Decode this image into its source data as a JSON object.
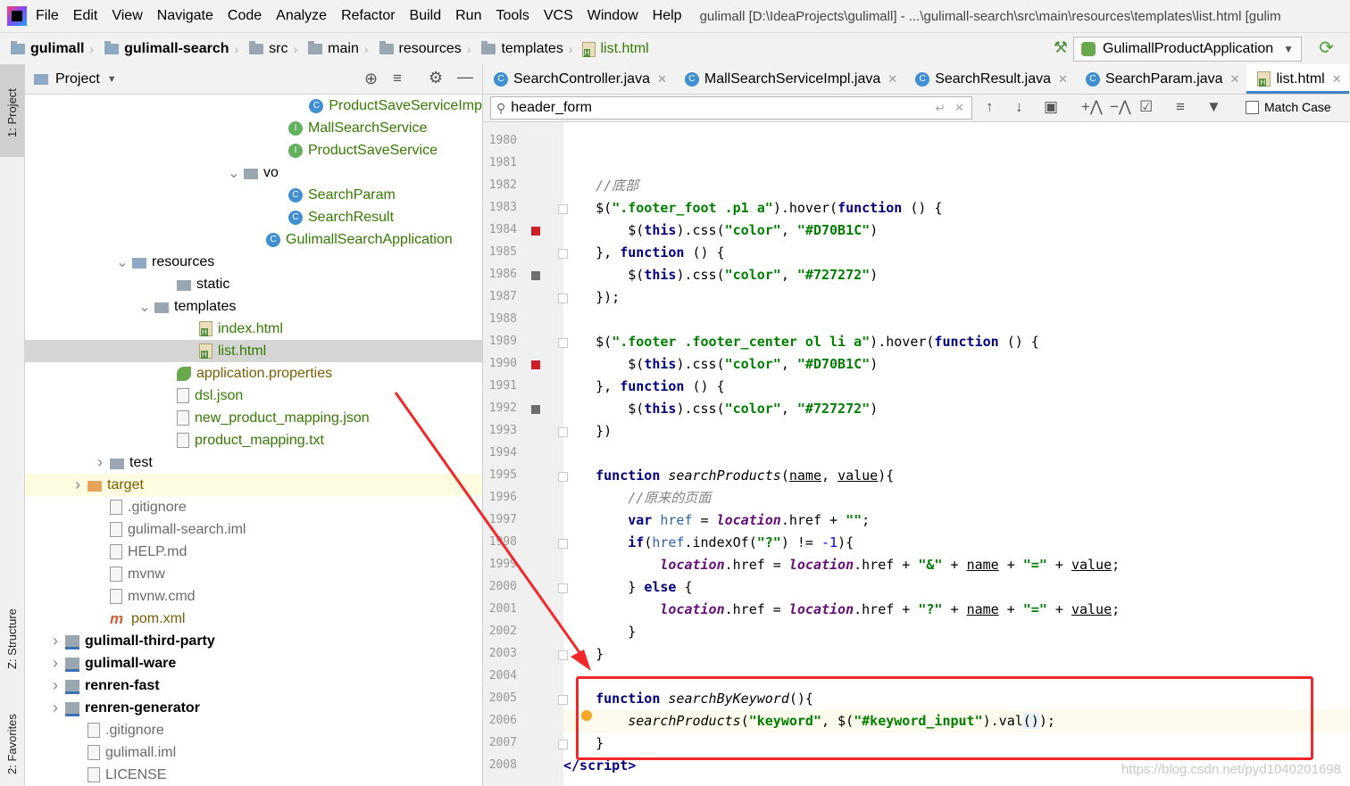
{
  "menubar": {
    "items": [
      "File",
      "Edit",
      "View",
      "Navigate",
      "Code",
      "Analyze",
      "Refactor",
      "Build",
      "Run",
      "Tools",
      "VCS",
      "Window",
      "Help"
    ],
    "title": "gulimall [D:\\IdeaProjects\\gulimall] - ...\\gulimall-search\\src\\main\\resources\\templates\\list.html [gulim"
  },
  "navbar": {
    "crumbs": [
      "gulimall",
      "gulimall-search",
      "src",
      "main",
      "resources",
      "templates",
      "list.html"
    ],
    "run_config": "GulimallProductApplication"
  },
  "left_stripe": {
    "project": "1: Project",
    "structure": "Z: Structure",
    "favorites": "2: Favorites"
  },
  "project_panel": {
    "title": "Project",
    "tree": [
      {
        "label": "ProductSaveServiceImp",
        "kind": "class",
        "depth": 13
      },
      {
        "label": "MallSearchService",
        "kind": "interface",
        "depth": 11
      },
      {
        "label": "ProductSaveService",
        "kind": "interface",
        "depth": 11
      },
      {
        "label": "vo",
        "kind": "folder",
        "depth": 9,
        "expanded": true
      },
      {
        "label": "SearchParam",
        "kind": "class",
        "depth": 11
      },
      {
        "label": "SearchResult",
        "kind": "class",
        "depth": 11
      },
      {
        "label": "GulimallSearchApplication",
        "kind": "class",
        "depth": 10
      },
      {
        "label": "resources",
        "kind": "resfolder",
        "depth": 4,
        "expanded": true
      },
      {
        "label": "static",
        "kind": "folder",
        "depth": 6
      },
      {
        "label": "templates",
        "kind": "folder",
        "depth": 5,
        "expanded": true
      },
      {
        "label": "index.html",
        "kind": "html",
        "depth": 7
      },
      {
        "label": "list.html",
        "kind": "html",
        "depth": 7,
        "selected": true
      },
      {
        "label": "application.properties",
        "kind": "props",
        "depth": 6
      },
      {
        "label": "dsl.json",
        "kind": "json",
        "depth": 6
      },
      {
        "label": "new_product_mapping.json",
        "kind": "json",
        "depth": 6
      },
      {
        "label": "product_mapping.txt",
        "kind": "txt",
        "depth": 6
      },
      {
        "label": "test",
        "kind": "folder",
        "depth": 3,
        "expanded": false
      },
      {
        "label": "target",
        "kind": "orange",
        "depth": 2,
        "expanded": false,
        "highlight": true
      },
      {
        "label": ".gitignore",
        "kind": "file",
        "depth": 3
      },
      {
        "label": "gulimall-search.iml",
        "kind": "file",
        "depth": 3
      },
      {
        "label": "HELP.md",
        "kind": "md",
        "depth": 3
      },
      {
        "label": "mvnw",
        "kind": "file",
        "depth": 3
      },
      {
        "label": "mvnw.cmd",
        "kind": "file",
        "depth": 3
      },
      {
        "label": "pom.xml",
        "kind": "maven",
        "depth": 3
      },
      {
        "label": "gulimall-third-party",
        "kind": "module",
        "depth": 1,
        "expanded": false
      },
      {
        "label": "gulimall-ware",
        "kind": "module",
        "depth": 1,
        "expanded": false
      },
      {
        "label": "renren-fast",
        "kind": "module",
        "depth": 1,
        "expanded": false
      },
      {
        "label": "renren-generator",
        "kind": "module",
        "depth": 1,
        "expanded": false
      },
      {
        "label": ".gitignore",
        "kind": "file",
        "depth": 2
      },
      {
        "label": "gulimall.iml",
        "kind": "file",
        "depth": 2
      },
      {
        "label": "LICENSE",
        "kind": "file",
        "depth": 2
      }
    ]
  },
  "editor_tabs": [
    {
      "label": "SearchController.java",
      "icon": "class-icon"
    },
    {
      "label": "MallSearchServiceImpl.java",
      "icon": "class-icon"
    },
    {
      "label": "SearchResult.java",
      "icon": "class-icon"
    },
    {
      "label": "SearchParam.java",
      "icon": "class-icon"
    },
    {
      "label": "list.html",
      "icon": "html-icon",
      "active": true
    }
  ],
  "search": {
    "value": "header_form",
    "match_case_label": "Match Case",
    "match_case_checked": false
  },
  "code": {
    "first_line_number": 1980,
    "current_line": 2006,
    "lines": [
      {
        "n": "1980",
        "html": ""
      },
      {
        "n": "1981",
        "html": ""
      },
      {
        "n": "1982",
        "html": "    <span class=\"cm\">//底部</span>"
      },
      {
        "n": "1983",
        "html": "    $(<span class=\"str\">\".footer_foot .p1 a\"</span>).hover(<span class=\"kw\">function</span> () {"
      },
      {
        "n": "1984",
        "html": "        $(<span class=\"kw\">this</span>).css(<span class=\"str\">\"color\"</span>, <span class=\"str\">\"#D70B1C\"</span>)"
      },
      {
        "n": "1985",
        "html": "    }, <span class=\"kw\">function</span> () {"
      },
      {
        "n": "1986",
        "html": "        $(<span class=\"kw\">this</span>).css(<span class=\"str\">\"color\"</span>, <span class=\"str\">\"#727272\"</span>)"
      },
      {
        "n": "1987",
        "html": "    });"
      },
      {
        "n": "1988",
        "html": ""
      },
      {
        "n": "1989",
        "html": "    $(<span class=\"str\">\".footer .footer_center ol li a\"</span>).hover(<span class=\"kw\">function</span> () {"
      },
      {
        "n": "1990",
        "html": "        $(<span class=\"kw\">this</span>).css(<span class=\"str\">\"color\"</span>, <span class=\"str\">\"#D70B1C\"</span>)"
      },
      {
        "n": "1991",
        "html": "    }, <span class=\"kw\">function</span> () {"
      },
      {
        "n": "1992",
        "html": "        $(<span class=\"kw\">this</span>).css(<span class=\"str\">\"color\"</span>, <span class=\"str\">\"#727272\"</span>)"
      },
      {
        "n": "1993",
        "html": "    })"
      },
      {
        "n": "1994",
        "html": ""
      },
      {
        "n": "1995",
        "html": "    <span class=\"kw\">function</span> <span class=\"fn\">searchProducts</span>(<span class=\"ul\">name</span>, <span class=\"ul\">value</span>){"
      },
      {
        "n": "1996",
        "html": "        <span class=\"cm\">//原来的页面</span>"
      },
      {
        "n": "1997",
        "html": "        <span class=\"kw\">var</span> <span class=\"var\">href</span> = <span class=\"gv\">location</span>.href + <span class=\"str\">\"\"</span>;"
      },
      {
        "n": "1998",
        "html": "        <span class=\"kw\">if</span>(<span class=\"var\">href</span>.indexOf(<span class=\"str\">\"?\"</span>) != <span class=\"num\">-1</span>){"
      },
      {
        "n": "1999",
        "html": "            <span class=\"gv\">location</span>.href = <span class=\"gv\">location</span>.href + <span class=\"str\">\"&amp;\"</span> + <span class=\"ul\">name</span> + <span class=\"str\">\"=\"</span> + <span class=\"ul\">value</span>;"
      },
      {
        "n": "2000",
        "html": "        } <span class=\"kw\">else</span> {"
      },
      {
        "n": "2001",
        "html": "            <span class=\"gv\">location</span>.href = <span class=\"gv\">location</span>.href + <span class=\"str\">\"?\"</span> + <span class=\"ul\">name</span> + <span class=\"str\">\"=\"</span> + <span class=\"ul\">value</span>;"
      },
      {
        "n": "2002",
        "html": "        }"
      },
      {
        "n": "2003",
        "html": "    }"
      },
      {
        "n": "2004",
        "html": ""
      },
      {
        "n": "2005",
        "html": "    <span class=\"kw\">function</span> <span class=\"fn\">searchByKeyword</span>(){"
      },
      {
        "n": "2006",
        "html": "        <span class=\"fn\">searchProducts</span>(<span class=\"str\">\"keyword\"</span>, $(<span class=\"str\">\"#keyword_input\"</span>).val<span class=\"bg-hl\">()</span>);"
      },
      {
        "n": "2007",
        "html": "    }"
      },
      {
        "n": "2008",
        "html": "<span class=\"tagc\">&lt;/script&gt;</span>"
      }
    ]
  },
  "watermark": "https://blog.csdn.net/pyd1040201698",
  "colors": {
    "accent": "#4083c9",
    "annotation": "#f1272a",
    "breakpoint": "#cc1f2a"
  }
}
